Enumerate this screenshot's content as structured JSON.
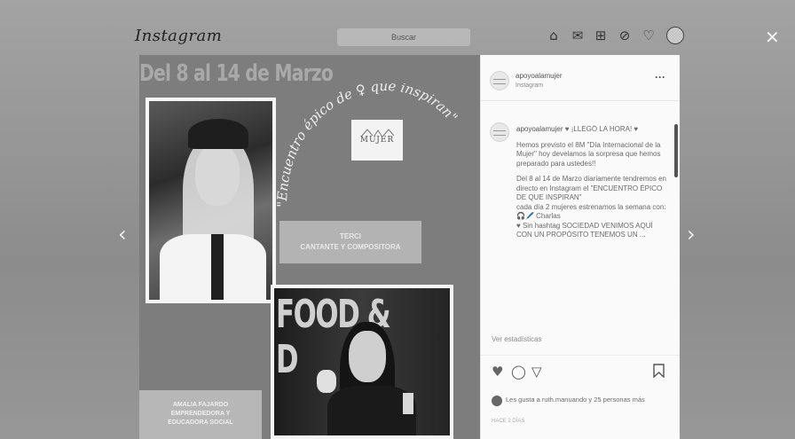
{
  "topbar": {
    "logo": "Instagram",
    "search_placeholder": "Buscar",
    "icons": [
      "home-icon",
      "messenger-icon",
      "new-post-icon",
      "explore-icon",
      "activity-heart-icon",
      "profile-avatar"
    ]
  },
  "controls": {
    "close": "✕",
    "prev": "‹",
    "next": "›"
  },
  "post_image": {
    "dates": "Del 8 al 14 de Marzo",
    "script_title": "\"Encuentro épico de ♀ que inspiran\"",
    "logo_text": "MUJER",
    "badge1_line1": "TERCI",
    "badge1_line2": "CANTANTE Y COMPOSITORA",
    "photo2_banner": "FOOD & D",
    "badge2_line1": "AMALIA FAJARDO",
    "badge2_line2": "EMPRENDEDORA Y",
    "badge2_line3": "EDUCADORA SOCIAL"
  },
  "panel": {
    "account_name": "apoyoalamujer",
    "account_sub": "Instagram",
    "more": "···",
    "caption_user": "apoyoalamujer",
    "caption_p1": "♥ ¡LLEGÓ LA HORA! ♥",
    "caption_p2": "Hemos previsto el 8M \"Día Internacional de la Mujer\" hoy develamos la sorpresa que hemos preparado para ustedes!!",
    "caption_p3": "Del 8 al 14 de Marzo diariamente tendremos en directo en Instagram el \"ENCUENTRO ÉPICO DE QUE INSPIRAN\"\ncada día 2 mujeres estrenamos la semana con:\n🎧🖊️ Charlas\n♥ Sin hashtag SOCIEDAD VENIMOS AQUÍ CON UN PROPÓSITO TENEMOS UN ...",
    "see_stats": "Ver estadísticas",
    "likes_text": "Les gusta a ruth.manuando y 25 personas más",
    "time_ago": "HACE 2 DÍAS",
    "action_icons": [
      "heart-icon",
      "comment-icon",
      "share-icon",
      "save-icon"
    ]
  }
}
